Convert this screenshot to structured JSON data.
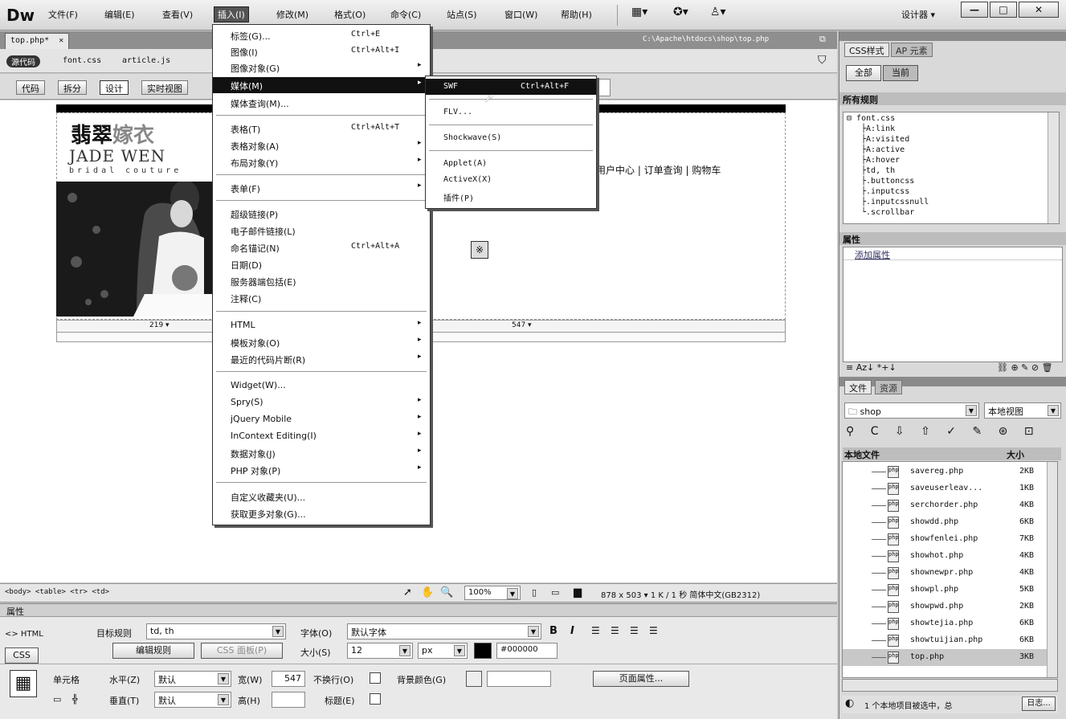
{
  "app": {
    "logo": "Dw"
  },
  "menubar": {
    "items": [
      "文件(F)",
      "编辑(E)",
      "查看(V)",
      "插入(I)",
      "修改(M)",
      "格式(O)",
      "命令(C)",
      "站点(S)",
      "窗口(W)",
      "帮助(H)"
    ],
    "workspace": "设计器",
    "window_controls": [
      "—",
      "□",
      "✕"
    ]
  },
  "doc": {
    "tab": "top.php*",
    "close": "✕",
    "path": "C:\\Apache\\htdocs\\shop\\top.php",
    "related": [
      "源代码",
      "font.css",
      "article.js"
    ],
    "views": [
      "代码",
      "拆分",
      "设计",
      "实时视图"
    ]
  },
  "page": {
    "logo_cn_a": "翡翠",
    "logo_cn_b": "嫁衣",
    "logo_en": "JADE WEN",
    "logo_sub": "bridal couture",
    "nav": "用户中心 | 订单查询 | 购物车",
    "swf_marker": "※",
    "width_left": "219 ▾",
    "width_right": "547 ▾"
  },
  "insert_menu": {
    "items": [
      {
        "label": "标签(G)...",
        "key": "Ctrl+E",
        "arrow": ""
      },
      {
        "label": "图像(I)",
        "key": "Ctrl+Alt+I",
        "arrow": ""
      },
      {
        "label": "图像对象(G)",
        "key": "",
        "arrow": "▸"
      },
      {
        "label": "媒体(M)",
        "key": "",
        "arrow": "▸"
      },
      {
        "label": "媒体查询(M)...",
        "key": "",
        "arrow": ""
      },
      {
        "label": "表格(T)",
        "key": "Ctrl+Alt+T",
        "arrow": ""
      },
      {
        "label": "表格对象(A)",
        "key": "",
        "arrow": "▸"
      },
      {
        "label": "布局对象(Y)",
        "key": "",
        "arrow": "▸"
      },
      {
        "label": "表单(F)",
        "key": "",
        "arrow": "▸"
      },
      {
        "label": "超级链接(P)",
        "key": "",
        "arrow": ""
      },
      {
        "label": "电子邮件链接(L)",
        "key": "",
        "arrow": ""
      },
      {
        "label": "命名锚记(N)",
        "key": "Ctrl+Alt+A",
        "arrow": ""
      },
      {
        "label": "日期(D)",
        "key": "",
        "arrow": ""
      },
      {
        "label": "服务器端包括(E)",
        "key": "",
        "arrow": ""
      },
      {
        "label": "注释(C)",
        "key": "",
        "arrow": ""
      },
      {
        "label": "HTML",
        "key": "",
        "arrow": "▸"
      },
      {
        "label": "模板对象(O)",
        "key": "",
        "arrow": "▸"
      },
      {
        "label": "最近的代码片断(R)",
        "key": "",
        "arrow": "▸"
      },
      {
        "label": "Widget(W)...",
        "key": "",
        "arrow": ""
      },
      {
        "label": "Spry(S)",
        "key": "",
        "arrow": "▸"
      },
      {
        "label": "jQuery Mobile",
        "key": "",
        "arrow": "▸"
      },
      {
        "label": "InContext Editing(I)",
        "key": "",
        "arrow": "▸"
      },
      {
        "label": "数据对象(J)",
        "key": "",
        "arrow": "▸"
      },
      {
        "label": "PHP 对象(P)",
        "key": "",
        "arrow": "▸"
      },
      {
        "label": "自定义收藏夹(U)...",
        "key": "",
        "arrow": ""
      },
      {
        "label": "获取更多对象(G)...",
        "key": "",
        "arrow": ""
      }
    ]
  },
  "media_submenu": {
    "items": [
      {
        "label": "SWF",
        "key": "Ctrl+Alt+F"
      },
      {
        "label": "FLV...",
        "key": ""
      },
      {
        "label": "Shockwave(S)",
        "key": ""
      },
      {
        "label": "Applet(A)",
        "key": ""
      },
      {
        "label": "ActiveX(X)",
        "key": ""
      },
      {
        "label": "插件(P)",
        "key": ""
      }
    ]
  },
  "status": {
    "tags": "<body> <table> <tr> <td>",
    "zoom": "100%",
    "info": "878 x 503 ▾ 1 K / 1 秒  简体中文(GB2312)"
  },
  "props": {
    "title": "属性",
    "html": "<> HTML",
    "css": "CSS",
    "target_rule_label": "目标规则",
    "target_rule": "td, th",
    "edit_rule": "编辑规则",
    "css_panel": "CSS 面板(P)",
    "font_label": "字体(O)",
    "font": "默认字体",
    "size_label": "大小(S)",
    "size": "12",
    "unit": "px",
    "color": "#000000",
    "bold": "B",
    "italic": "I",
    "cell_label": "单元格",
    "horz_label": "水平(Z)",
    "horz": "默认",
    "vert_label": "垂直(T)",
    "vert": "默认",
    "width_label": "宽(W)",
    "width": "547",
    "height_label": "高(H)",
    "height": "",
    "nowrap_label": "不换行(O)",
    "header_label": "标题(E)",
    "bg_label": "背景颜色(G)",
    "page_props": "页面属性..."
  },
  "css_panel": {
    "tabs": [
      "CSS样式",
      "AP 元素"
    ],
    "modes": [
      "全部",
      "当前"
    ],
    "all_rules": "所有规则",
    "rules": [
      "font.css",
      "A:link",
      "A:visited",
      "A:active",
      "A:hover",
      "td, th",
      ".buttoncss",
      ".inputcss",
      ".inputcssnull",
      ".scrollbar"
    ],
    "props_title": "属性",
    "add_prop": "添加属性"
  },
  "files_panel": {
    "tabs": [
      "文件",
      "资源"
    ],
    "site": "shop",
    "view": "本地视图",
    "col_name": "本地文件",
    "col_size": "大小",
    "files": [
      {
        "name": "savereg.php",
        "size": "2KB"
      },
      {
        "name": "saveuserleav...",
        "size": "1KB"
      },
      {
        "name": "serchorder.php",
        "size": "4KB"
      },
      {
        "name": "showdd.php",
        "size": "6KB"
      },
      {
        "name": "showfenlei.php",
        "size": "7KB"
      },
      {
        "name": "showhot.php",
        "size": "4KB"
      },
      {
        "name": "shownewpr.php",
        "size": "4KB"
      },
      {
        "name": "showpl.php",
        "size": "5KB"
      },
      {
        "name": "showpwd.php",
        "size": "2KB"
      },
      {
        "name": "showtejia.php",
        "size": "6KB"
      },
      {
        "name": "showtuijian.php",
        "size": "6KB"
      },
      {
        "name": "top.php",
        "size": "3KB"
      }
    ],
    "status": "1 个本地项目被选中，总",
    "log": "日志..."
  }
}
